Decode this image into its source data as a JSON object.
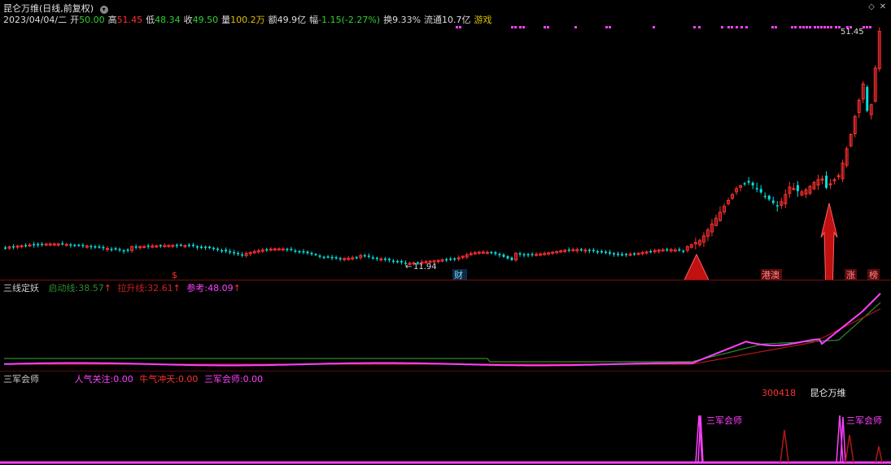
{
  "main": {
    "title": "昆仑万维(日线,前复权)",
    "date": "2023/04/04/二",
    "open_label": "开",
    "open": "50.00",
    "high_label": "高",
    "high": "51.45",
    "low_label": "低",
    "low": "48.34",
    "close_label": "收",
    "close": "49.50",
    "vol_label": "量",
    "vol": "100.2万",
    "amt_label": "额",
    "amt": "49.9亿",
    "chg_label": "幅",
    "chg": "-1.15(-2.27%)",
    "turn_label": "换",
    "turn": "9.33%",
    "float_label": "流通",
    "float": "10.7亿",
    "sector": "游戏",
    "price_high_mark": "51.45",
    "price_low_mark": "11.94",
    "event_labels": [
      "$",
      "财",
      "港澳",
      "涨",
      "榜"
    ]
  },
  "sub1": {
    "title": "三线定妖",
    "l1_label": "启动线:",
    "l1_value": "38.57",
    "l2_label": "拉升线:",
    "l2_value": "32.61",
    "l3_label": "参考:",
    "l3_value": "48.09",
    "arrow": "↑"
  },
  "sub2": {
    "title": "三军会师",
    "i1_label": "人气关注:",
    "i1_value": "0.00",
    "i2_label": "牛气冲天:",
    "i2_value": "0.00",
    "i3_label": "三军会师:",
    "i3_value": "0.00",
    "stock_code": "300418",
    "stock_name": "昆仑万维",
    "signal_label": "三军会师"
  },
  "colors": {
    "up": "#ff3030",
    "down": "#00e0e0",
    "magenta": "#ff40ff",
    "green": "#2e8b2e",
    "darkred": "#b01818",
    "yellow": "#d8c000"
  }
}
